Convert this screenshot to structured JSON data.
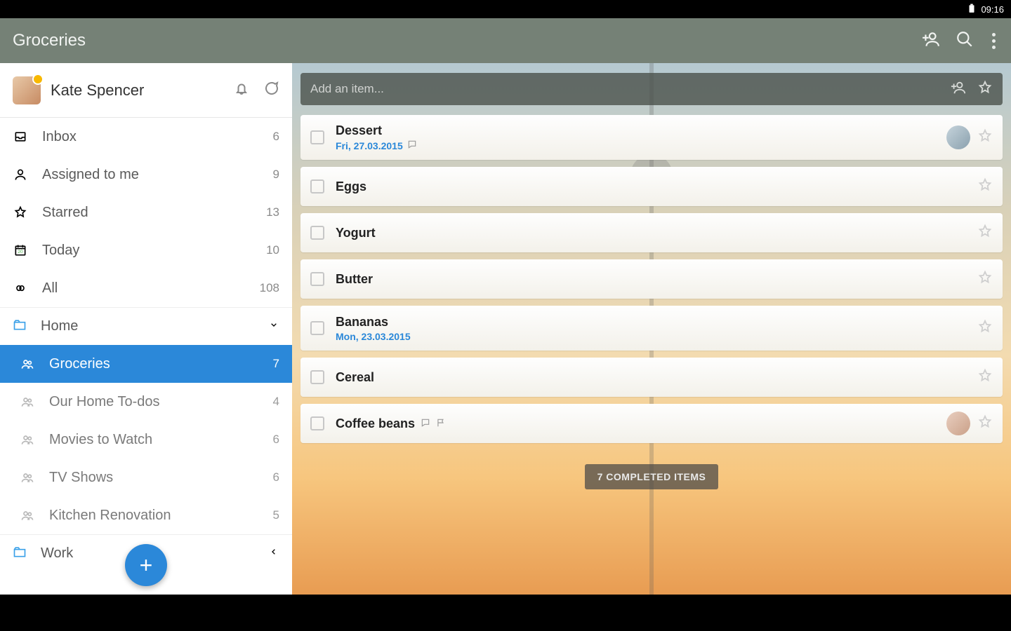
{
  "status": {
    "time": "09:16"
  },
  "topbar": {
    "title": "Groceries"
  },
  "user": {
    "name": "Kate Spencer"
  },
  "smart": [
    {
      "id": "inbox",
      "label": "Inbox",
      "count": "6",
      "icon": "inbox",
      "color": "#3aa0e8"
    },
    {
      "id": "assigned",
      "label": "Assigned to me",
      "count": "9",
      "icon": "person",
      "color": "#f0a637"
    },
    {
      "id": "starred",
      "label": "Starred",
      "count": "13",
      "icon": "star",
      "color": "#e34b3d"
    },
    {
      "id": "today",
      "label": "Today",
      "count": "10",
      "icon": "calendar",
      "color": "#4eb14e"
    },
    {
      "id": "all",
      "label": "All",
      "count": "108",
      "icon": "infinity",
      "color": "#8a8a8a"
    }
  ],
  "folders": {
    "home": {
      "label": "Home",
      "expanded": true,
      "lists": [
        {
          "id": "groceries",
          "label": "Groceries",
          "count": "7",
          "active": true
        },
        {
          "id": "todos",
          "label": "Our Home To-dos",
          "count": "4",
          "active": false
        },
        {
          "id": "movies",
          "label": "Movies to Watch",
          "count": "6",
          "active": false
        },
        {
          "id": "tv",
          "label": "TV Shows",
          "count": "6",
          "active": false
        },
        {
          "id": "kitchen",
          "label": "Kitchen Renovation",
          "count": "5",
          "active": false
        }
      ]
    },
    "work": {
      "label": "Work",
      "expanded": false
    }
  },
  "addbar": {
    "placeholder": "Add an item..."
  },
  "tasks": [
    {
      "title": "Dessert",
      "date": "Fri, 27.03.2015",
      "has_comment": true,
      "has_flag": false,
      "assignee": "m"
    },
    {
      "title": "Eggs"
    },
    {
      "title": "Yogurt"
    },
    {
      "title": "Butter"
    },
    {
      "title": "Bananas",
      "date": "Mon, 23.03.2015"
    },
    {
      "title": "Cereal"
    },
    {
      "title": "Coffee beans",
      "has_comment": true,
      "has_flag": true,
      "assignee": "f"
    }
  ],
  "completed_label": "7 COMPLETED ITEMS"
}
